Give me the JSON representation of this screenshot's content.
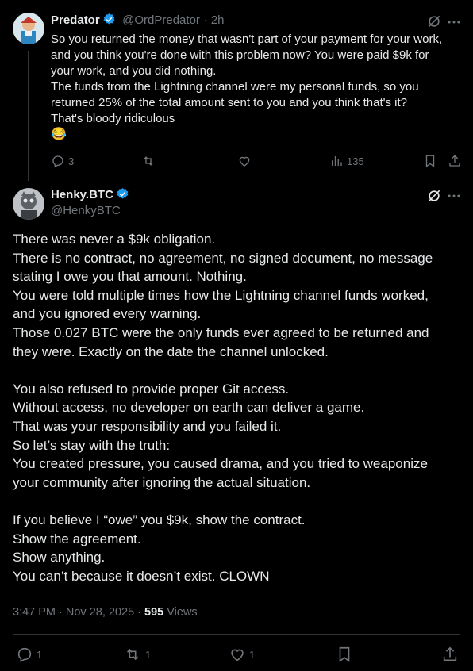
{
  "reply": {
    "name": "Predator",
    "handle": "@OrdPredator",
    "sep": "·",
    "time": "2h",
    "lines": [
      "So you returned the money that wasn't part of your payment for your work,",
      "and you think you're done with this problem now? You were paid $9k for",
      "your work, and you did nothing.",
      "The funds from the Lightning channel were my personal funds, so you",
      "returned 25% of the total amount sent to you and you think that's it?",
      "That's bloody ridiculous"
    ],
    "emoji": "😂",
    "replies": "3",
    "views": "135"
  },
  "main": {
    "name": "Henky.BTC",
    "handle": "@HenkyBTC",
    "paragraphs": [
      [
        "There was never a $9k obligation.",
        "There is no contract, no agreement, no signed document, no message",
        "stating I owe you that amount. Nothing.",
        "You were told multiple times how the Lightning channel funds worked,",
        "and you ignored every warning.",
        "Those 0.027 BTC were the only funds ever agreed to be returned and",
        "they were. Exactly on the date the channel unlocked."
      ],
      [
        "You also refused to provide proper Git access.",
        "Without access, no developer on earth can deliver a game.",
        "That was your responsibility  and you failed it.",
        "So let’s stay with the truth:",
        "You created pressure, you caused drama, and you tried to weaponize",
        "your community after ignoring the actual situation."
      ],
      [
        "If you believe I “owe” you $9k, show the contract.",
        "Show the agreement.",
        "Show anything.",
        "You can’t because it doesn’t exist. CLOWN"
      ]
    ],
    "timestamp": "3:47 PM · Nov 28, 2025 · ",
    "views_count": "595",
    "views_label": " Views",
    "replies": "1",
    "reposts": "1",
    "likes": "1"
  },
  "colors": {
    "background": "#000000",
    "text": "#e7e9ea",
    "muted": "#71767b",
    "verified": "#1d9bf0"
  },
  "icons": [
    "grok-icon",
    "more-icon",
    "reply-icon",
    "repost-icon",
    "like-icon",
    "views-icon",
    "bookmark-icon",
    "share-icon",
    "verified-icon"
  ]
}
